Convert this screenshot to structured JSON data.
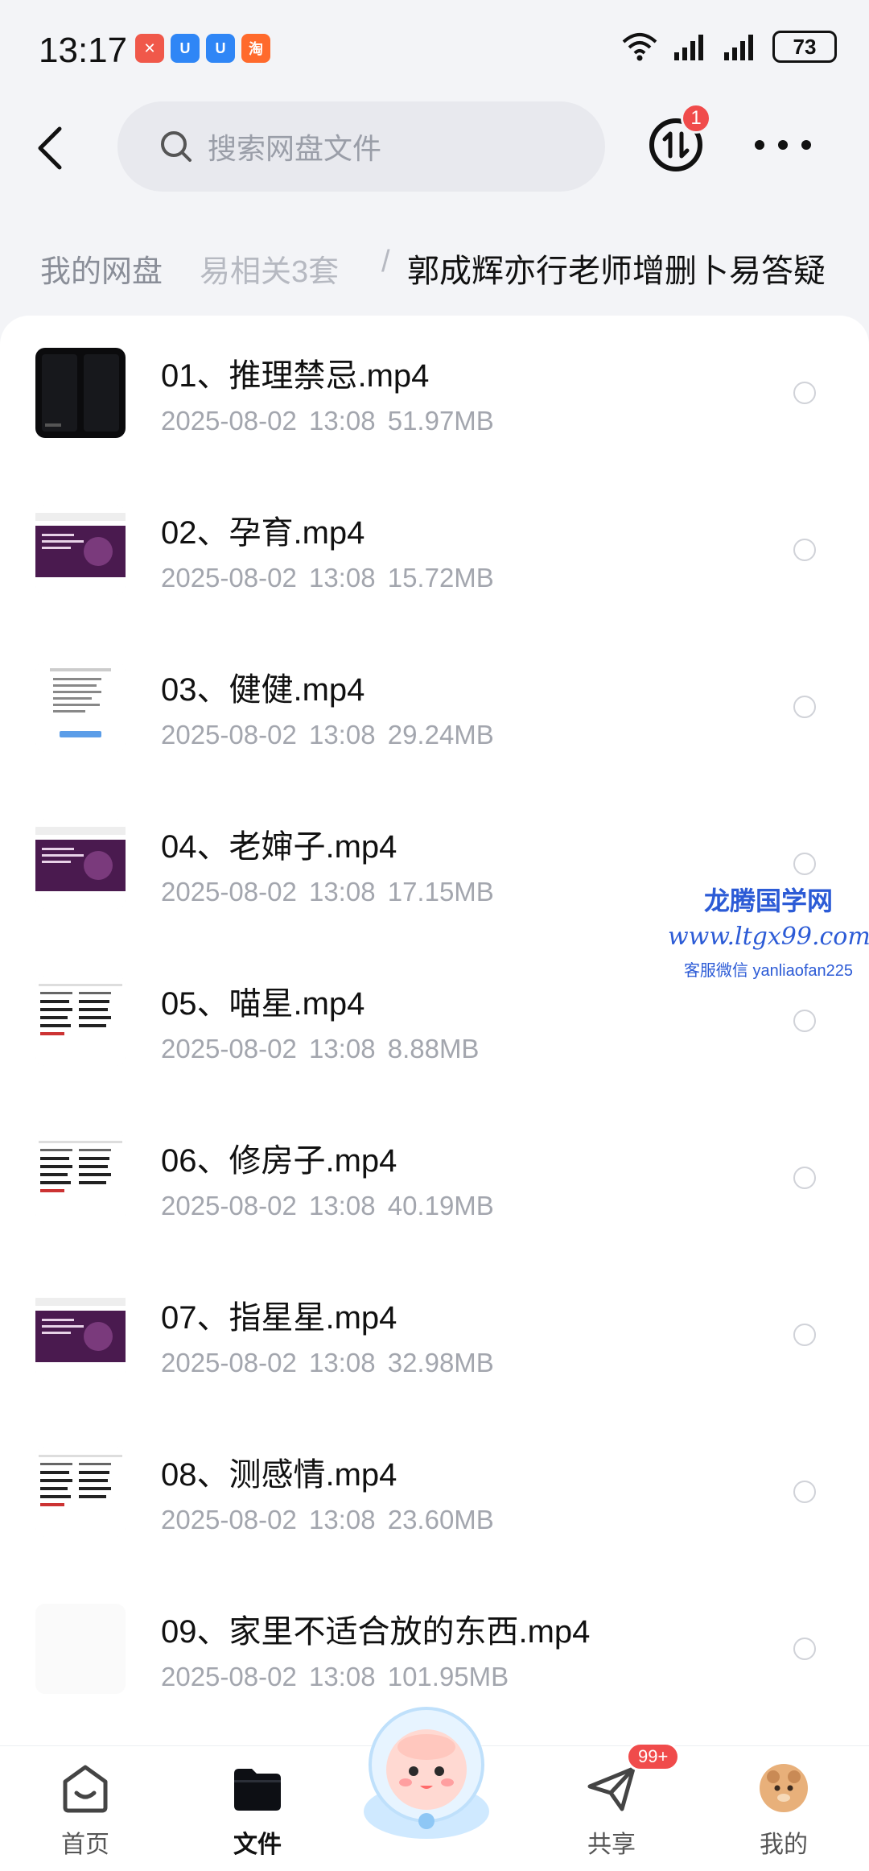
{
  "status_bar": {
    "time": "13:17",
    "battery": "73",
    "app_badges": [
      {
        "icon": "app-red-icon",
        "color": "#f0584a",
        "glyph": "✕"
      },
      {
        "icon": "app-blue-icon",
        "color": "#2f86f6",
        "glyph": "U"
      },
      {
        "icon": "app-blue-icon-2",
        "color": "#2f86f6",
        "glyph": "U"
      },
      {
        "icon": "taobao-icon",
        "color": "#ff6a2c",
        "glyph": "淘"
      }
    ]
  },
  "header": {
    "search_placeholder": "搜索网盘文件",
    "notification_count": "1"
  },
  "breadcrumb": {
    "root": "我的网盘",
    "middle": "易相关3套",
    "separator": "/",
    "current": "郭成辉亦行老师增删卜易答疑"
  },
  "files": [
    {
      "name": "01、推理禁忌.mp4",
      "date": "2025-08-02",
      "time": "13:08",
      "size": "51.97MB",
      "thumb": "dark"
    },
    {
      "name": "02、孕育.mp4",
      "date": "2025-08-02",
      "time": "13:08",
      "size": "15.72MB",
      "thumb": "purple"
    },
    {
      "name": "03、健健.mp4",
      "date": "2025-08-02",
      "time": "13:08",
      "size": "29.24MB",
      "thumb": "doc"
    },
    {
      "name": "04、老婶子.mp4",
      "date": "2025-08-02",
      "time": "13:08",
      "size": "17.15MB",
      "thumb": "purple"
    },
    {
      "name": "05、喵星.mp4",
      "date": "2025-08-02",
      "time": "13:08",
      "size": "8.88MB",
      "thumb": "table"
    },
    {
      "name": "06、修房子.mp4",
      "date": "2025-08-02",
      "time": "13:08",
      "size": "40.19MB",
      "thumb": "table"
    },
    {
      "name": "07、指星星.mp4",
      "date": "2025-08-02",
      "time": "13:08",
      "size": "32.98MB",
      "thumb": "purple"
    },
    {
      "name": "08、测感情.mp4",
      "date": "2025-08-02",
      "time": "13:08",
      "size": "23.60MB",
      "thumb": "table"
    },
    {
      "name": "09、家里不适合放的东西.mp4",
      "date": "2025-08-02",
      "time": "13:08",
      "size": "101.95MB",
      "thumb": "blank"
    }
  ],
  "watermark": {
    "line1": "龙腾国学网",
    "line2": "www.ltgx99.com",
    "line3": "客服微信 yanliaofan225"
  },
  "bottom_nav": {
    "home": "首页",
    "files": "文件",
    "share": "共享",
    "share_badge": "99+",
    "mine": "我的"
  }
}
